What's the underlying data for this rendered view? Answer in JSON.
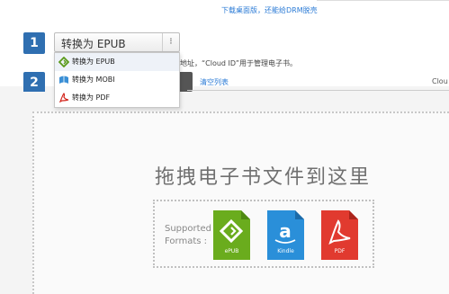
{
  "top": {
    "link": "下载桌面版，还能给DRM脱壳"
  },
  "step1": {
    "number": "1",
    "selected": "转换为 EPUB",
    "caret": "⁝"
  },
  "dropdown": {
    "items": [
      {
        "label": "转换为 EPUB",
        "icon": "epub-icon"
      },
      {
        "label": "转换为 MOBI",
        "icon": "mobi-icon"
      },
      {
        "label": "转换为 PDF",
        "icon": "pdf-icon"
      }
    ]
  },
  "step2": {
    "number": "2",
    "hint": "地址，“Cloud ID”用于管理电子书。",
    "clear": "清空列表",
    "cloud": "Clou"
  },
  "dropzone": {
    "title": "拖拽电子书文件到这里",
    "supported_line1": "Supported",
    "supported_line2": "Formats :",
    "formats": [
      {
        "name": "ePUB",
        "color": "#6aac1d"
      },
      {
        "name": "Kindle",
        "color": "#2a8fd9"
      },
      {
        "name": "PDF",
        "color": "#e13a2f"
      }
    ]
  }
}
